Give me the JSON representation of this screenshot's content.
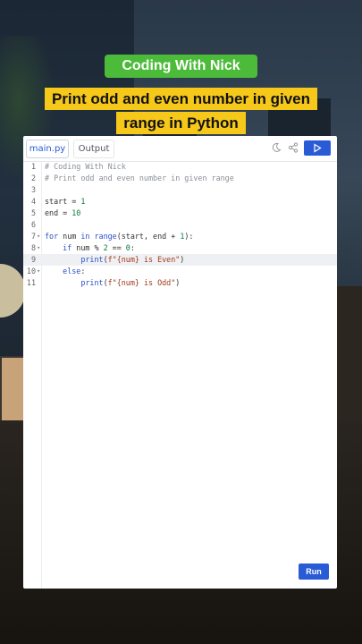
{
  "header": {
    "brand": "Coding With Nick",
    "title": "Print odd and even number in given range in Python"
  },
  "editor": {
    "tabs": [
      {
        "label": "main.py",
        "active": true
      },
      {
        "label": "Output",
        "active": false
      }
    ],
    "icons": [
      "moon-icon",
      "share-icon",
      "play-icon"
    ],
    "run_label": "Run",
    "highlighted_line": 9,
    "lines": [
      {
        "n": "1",
        "fold": "",
        "text": "# Coding With Nick"
      },
      {
        "n": "2",
        "fold": "",
        "text": "# Print odd and even number in given range"
      },
      {
        "n": "3",
        "fold": "",
        "text": ""
      },
      {
        "n": "4",
        "fold": "",
        "text": "start = 1"
      },
      {
        "n": "5",
        "fold": "",
        "text": "end = 10"
      },
      {
        "n": "6",
        "fold": "",
        "text": ""
      },
      {
        "n": "7",
        "fold": "▾",
        "text": "for num in range(start, end + 1):"
      },
      {
        "n": "8",
        "fold": "▾",
        "text": "    if num % 2 == 0:"
      },
      {
        "n": "9",
        "fold": "",
        "text": "        print(f\"{num} is Even\")"
      },
      {
        "n": "10",
        "fold": "▾",
        "text": "    else:"
      },
      {
        "n": "11",
        "fold": "",
        "text": "        print(f\"{num} is Odd\")"
      }
    ]
  },
  "colors": {
    "accent": "#2a5bd7",
    "brand_badge": "#4cbb3a",
    "title_highlight": "#f6c81a"
  }
}
